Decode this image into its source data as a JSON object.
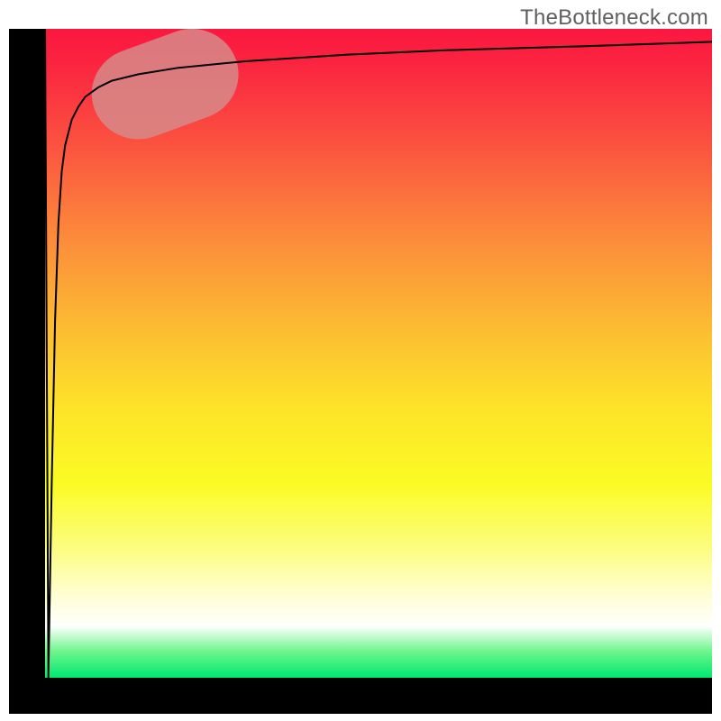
{
  "attribution": "TheBottleneck.com",
  "chart_data": {
    "type": "line",
    "title": "",
    "xlabel": "",
    "ylabel": "",
    "xlim": [
      0,
      100
    ],
    "ylim": [
      0,
      100
    ],
    "series": [
      {
        "name": "curve",
        "x": [
          0.0,
          0.5,
          1.0,
          1.5,
          2.0,
          2.5,
          3.0,
          4.0,
          5.0,
          6.0,
          8.0,
          10.0,
          14.0,
          20.0,
          30.0,
          45.0,
          60.0,
          80.0,
          100.0
        ],
        "y": [
          100.0,
          0.0,
          30.0,
          55.0,
          70.0,
          78.0,
          82.0,
          86.0,
          88.0,
          89.5,
          91.0,
          92.0,
          93.0,
          94.0,
          95.0,
          96.0,
          96.7,
          97.3,
          98.0
        ]
      }
    ],
    "highlight_segment": {
      "x_start": 14.0,
      "x_end": 22.0,
      "y_start": 90.0,
      "y_end": 93.0,
      "color": "#d68a8a"
    },
    "gradient_stops": [
      {
        "offset": 0.0,
        "color": "#fb1740"
      },
      {
        "offset": 0.05,
        "color": "#fb2340"
      },
      {
        "offset": 0.18,
        "color": "#fb5340"
      },
      {
        "offset": 0.32,
        "color": "#fc8a3b"
      },
      {
        "offset": 0.45,
        "color": "#fcb833"
      },
      {
        "offset": 0.58,
        "color": "#fde229"
      },
      {
        "offset": 0.7,
        "color": "#fbfb24"
      },
      {
        "offset": 0.8,
        "color": "#fdfd80"
      },
      {
        "offset": 0.87,
        "color": "#fefed0"
      },
      {
        "offset": 0.92,
        "color": "#ffffff"
      },
      {
        "offset": 0.96,
        "color": "#6cf58b"
      },
      {
        "offset": 1.0,
        "color": "#00e873"
      }
    ]
  }
}
